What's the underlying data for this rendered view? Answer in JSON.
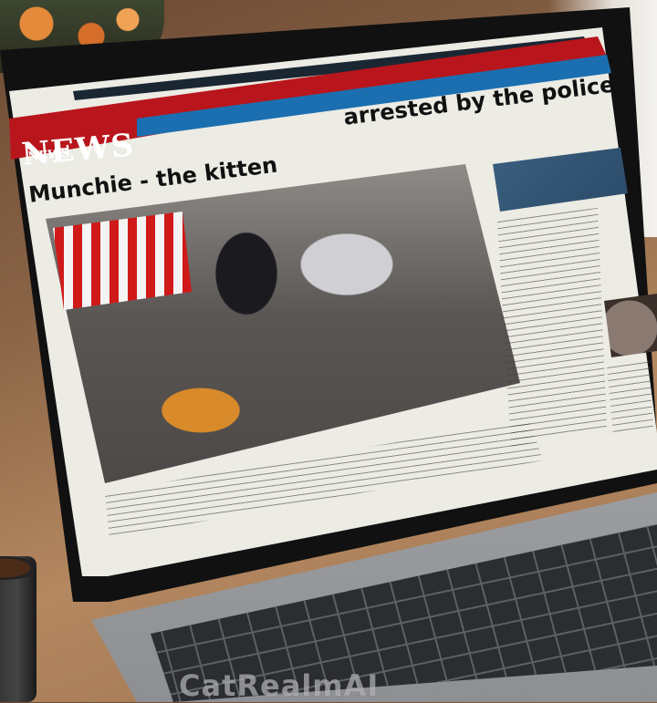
{
  "article": {
    "masthead": "NEWS",
    "sub_masthead": "NEWS",
    "headline_part1": "Munchie - the kitten",
    "headline_part2": "arrested by the police"
  },
  "watermark": {
    "text": "CatRealmAI"
  },
  "colors": {
    "banner_red": "#b8161c",
    "banner_blue": "#1b6fb0",
    "paper": "#ecebe4"
  }
}
